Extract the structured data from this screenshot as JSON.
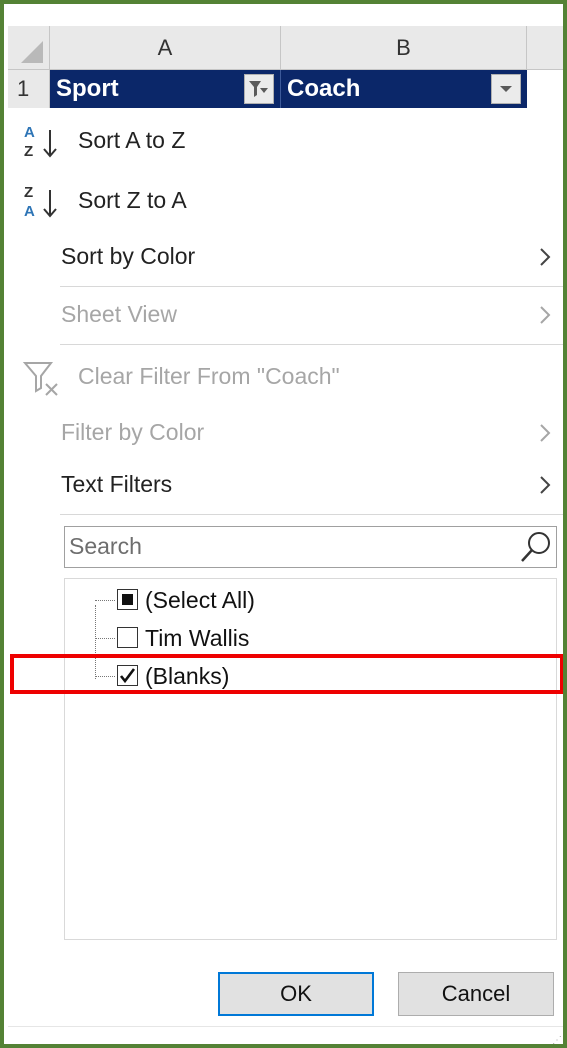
{
  "grid": {
    "col_a": "A",
    "col_b": "B",
    "row_number": "1",
    "header_a": "Sport",
    "header_b": "Coach"
  },
  "menu": {
    "sort_az_label": "Sort A to Z",
    "sort_za_label": "Sort Z to A",
    "sort_by_color_label": "Sort by Color",
    "sheet_view_label": "Sheet View",
    "clear_filter_label": "Clear Filter From \"Coach\"",
    "filter_by_color_label": "Filter by Color",
    "text_filters_label": "Text Filters"
  },
  "search": {
    "placeholder": "Search"
  },
  "list": [
    {
      "label": "(Select All)",
      "state": "indeterminate"
    },
    {
      "label": "Tim Wallis",
      "state": "unchecked"
    },
    {
      "label": "(Blanks)",
      "state": "checked"
    }
  ],
  "buttons": {
    "ok": "OK",
    "cancel": "Cancel"
  },
  "colors": {
    "header_fill": "#0b2769",
    "frame_border": "#548235",
    "highlight_box": "#ee0000",
    "ok_focus": "#0078d7"
  }
}
